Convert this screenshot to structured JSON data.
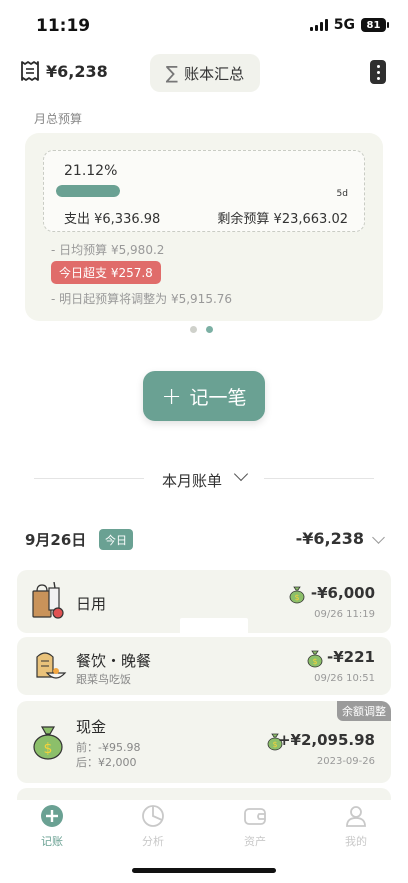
{
  "status": {
    "time": "11:19",
    "network": "5G",
    "battery": "81"
  },
  "header": {
    "total": "¥6,238",
    "summary_label": "账本汇总"
  },
  "budget": {
    "section_label": "月总预算",
    "percent": "21.12%",
    "progress": 0.2112,
    "days_left": "5d",
    "spent": "支出 ¥6,336.98",
    "remaining": "剩余预算 ¥23,663.02",
    "daily": "- 日均预算 ¥5,980.2",
    "over": "今日超支 ¥257.8",
    "adjust": "- 明日起预算将调整为 ¥5,915.76"
  },
  "record_button": {
    "plus": "+",
    "label": "记一笔"
  },
  "bill": {
    "title": "本月账单"
  },
  "day": {
    "date": "9月26日",
    "today_badge": "今日",
    "total": "-¥6,238"
  },
  "transactions": [
    {
      "title": "日用",
      "note": "",
      "amount": "-¥6,000",
      "time": "09/26 11:19",
      "icon": "groceries-bag-icon"
    },
    {
      "title": "餐饮・晚餐",
      "note": "跟菜鸟吃饭",
      "amount": "-¥221",
      "time": "09/26 10:51",
      "icon": "bread-bowl-icon"
    },
    {
      "title": "现金",
      "before": "前：-¥95.98",
      "after": "后：¥2,000",
      "amount": "+¥2,095.98",
      "time": "2023-09-26",
      "tag": "余额调整",
      "icon": "money-bag-icon"
    }
  ],
  "tabs": [
    {
      "label": "记账",
      "icon": "plus-circle-icon",
      "active": true
    },
    {
      "label": "分析",
      "icon": "pie-chart-icon",
      "active": false
    },
    {
      "label": "资产",
      "icon": "wallet-icon",
      "active": false
    },
    {
      "label": "我的",
      "icon": "user-icon",
      "active": false
    }
  ],
  "colors": {
    "accent": "#6aa193",
    "danger": "#e06c6a",
    "card": "#f3f4ee"
  }
}
